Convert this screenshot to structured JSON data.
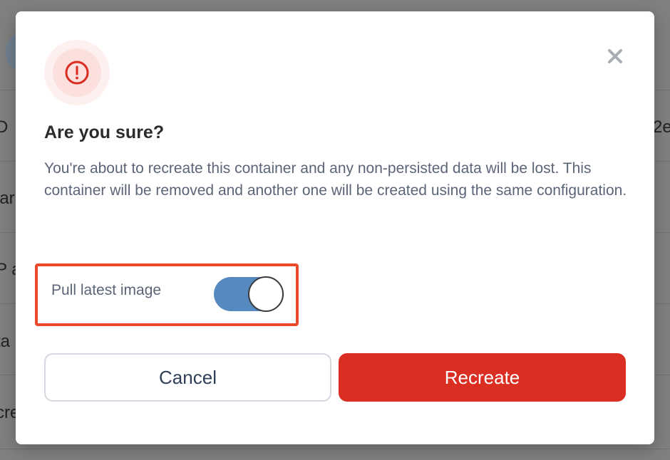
{
  "background": {
    "fragments": [
      "D",
      "2e",
      "lar",
      "P a",
      "ta",
      "cre"
    ]
  },
  "dialog": {
    "icon": "warning-icon",
    "close_icon": "close-icon",
    "title": "Are you sure?",
    "message": "You're about to recreate this container and any non-persisted data will be lost. This container will be removed and another one will be created using the same configuration.",
    "pull_latest_image": {
      "label": "Pull latest image",
      "checked": true
    },
    "buttons": {
      "cancel": "Cancel",
      "confirm": "Recreate"
    }
  },
  "colors": {
    "danger": "#da2e23",
    "toggle_on": "#5689c0",
    "highlight": "#ea4a2a",
    "text_muted": "#5b6577"
  }
}
